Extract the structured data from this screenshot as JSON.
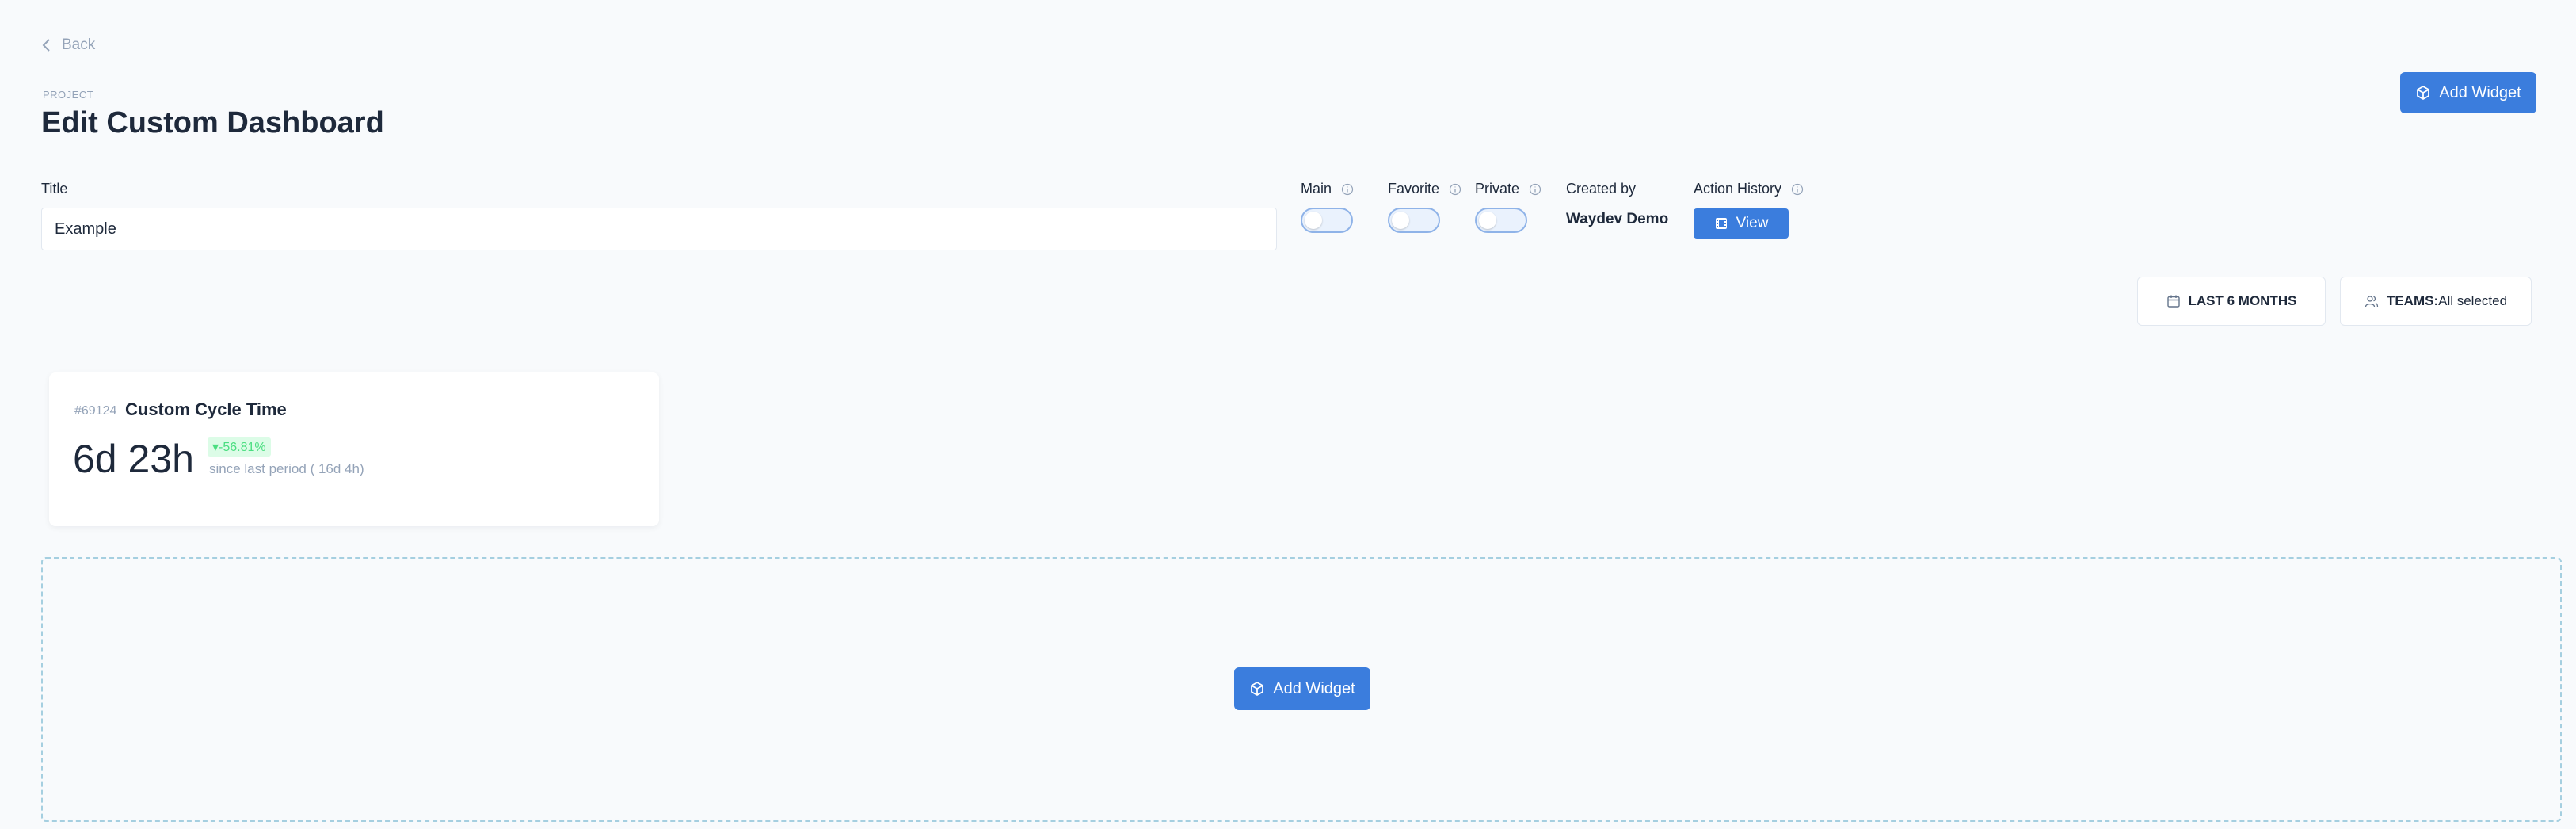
{
  "header": {
    "back_label": "Back",
    "eyebrow": "PROJECT",
    "title": "Edit Custom Dashboard",
    "add_widget_label": "Add Widget"
  },
  "form": {
    "title_label": "Title",
    "title_value": "Example",
    "toggles": [
      {
        "label": "Main",
        "on": false
      },
      {
        "label": "Favorite",
        "on": false
      },
      {
        "label": "Private",
        "on": false
      }
    ],
    "created_by_label": "Created by",
    "created_by_value": "Waydev Demo",
    "action_history_label": "Action History",
    "view_label": "View"
  },
  "filters": {
    "period_label": "LAST 6 MONTHS",
    "teams_prefix": "TEAMS:",
    "teams_value": "All selected"
  },
  "widget": {
    "id": "#69124",
    "name": "Custom Cycle Time",
    "value": "6d 23h",
    "change": "▾-56.81%",
    "comparison": "since last period ( 16d 4h)"
  },
  "dropzone": {
    "add_widget_label": "Add Widget"
  },
  "colors": {
    "primary": "#3b7ddd",
    "background": "#f8fafc",
    "positive_badge_bg": "#dcfce7",
    "positive_badge_text": "#4ade80"
  }
}
